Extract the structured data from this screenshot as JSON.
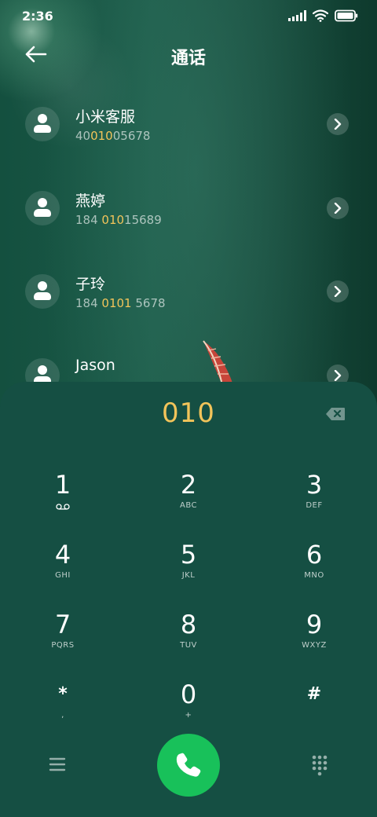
{
  "status_bar": {
    "time": "2:36"
  },
  "header": {
    "title": "通话"
  },
  "results": [
    {
      "name": "小米客服",
      "number_pre": "40",
      "number_hl": "010",
      "number_post": "05678"
    },
    {
      "name": "燕婷",
      "number_pre": "184 ",
      "number_hl": "010",
      "number_post": "15689"
    },
    {
      "name": "子玲",
      "number_pre": "184 ",
      "number_hl": "0101",
      "number_post": " 5678"
    },
    {
      "name": "Jason",
      "number_pre": "",
      "number_hl": "",
      "number_post": ""
    }
  ],
  "dialer": {
    "input": "010",
    "keys": [
      {
        "digit": "1",
        "letters": ""
      },
      {
        "digit": "2",
        "letters": "ABC"
      },
      {
        "digit": "3",
        "letters": "DEF"
      },
      {
        "digit": "4",
        "letters": "GHI"
      },
      {
        "digit": "5",
        "letters": "JKL"
      },
      {
        "digit": "6",
        "letters": "MNO"
      },
      {
        "digit": "7",
        "letters": "PQRS"
      },
      {
        "digit": "8",
        "letters": "TUV"
      },
      {
        "digit": "9",
        "letters": "WXYZ"
      },
      {
        "digit": "*",
        "letters": ","
      },
      {
        "digit": "0",
        "letters": "+"
      },
      {
        "digit": "#",
        "letters": ""
      }
    ]
  },
  "icons": {
    "voicemail": "voicemail-icon",
    "back": "back-arrow-icon",
    "delete": "backspace-icon",
    "menu": "menu-icon",
    "call": "phone-icon",
    "keypad": "keypad-icon"
  },
  "colors": {
    "highlight": "#f2c45a",
    "call": "#18c15a",
    "panel": "#154f43"
  }
}
